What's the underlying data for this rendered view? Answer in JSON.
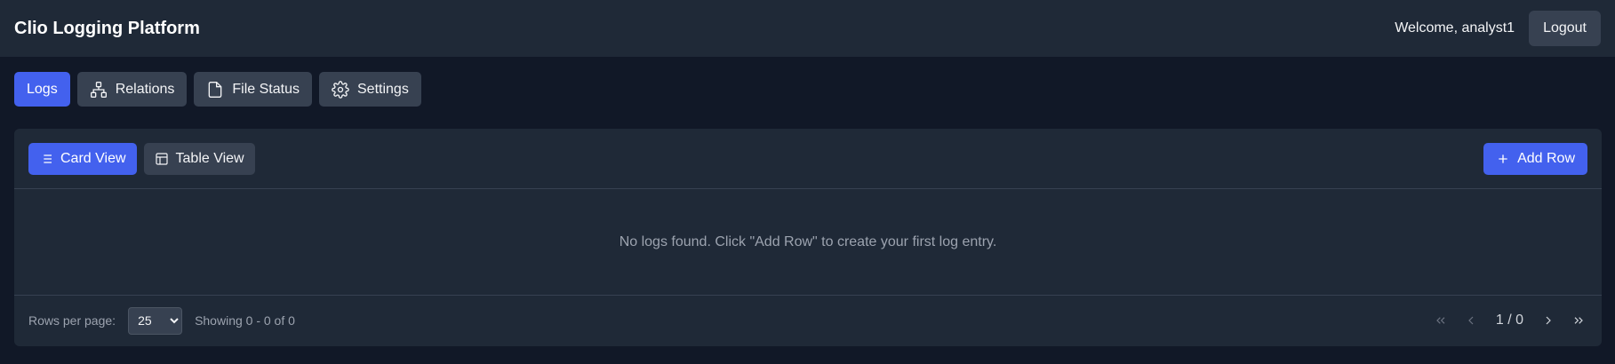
{
  "header": {
    "title": "Clio Logging Platform",
    "welcome": "Welcome, analyst1",
    "logout_label": "Logout"
  },
  "tabs": [
    {
      "label": "Logs",
      "icon": "list-icon",
      "active": true
    },
    {
      "label": "Relations",
      "icon": "network-icon",
      "active": false
    },
    {
      "label": "File Status",
      "icon": "file-icon",
      "active": false
    },
    {
      "label": "Settings",
      "icon": "gear-icon",
      "active": false
    }
  ],
  "toolbar": {
    "card_view_label": "Card View",
    "table_view_label": "Table View",
    "add_row_label": "Add Row"
  },
  "empty_message": "No logs found. Click \"Add Row\" to create your first log entry.",
  "footer": {
    "rows_per_page_label": "Rows per page:",
    "rows_per_page_value": "25",
    "showing_text": "Showing 0 - 0 of 0",
    "page_indicator": "1 / 0"
  },
  "colors": {
    "background": "#111827",
    "panel": "#1f2937",
    "accent": "#4361ee",
    "button": "#374151"
  }
}
